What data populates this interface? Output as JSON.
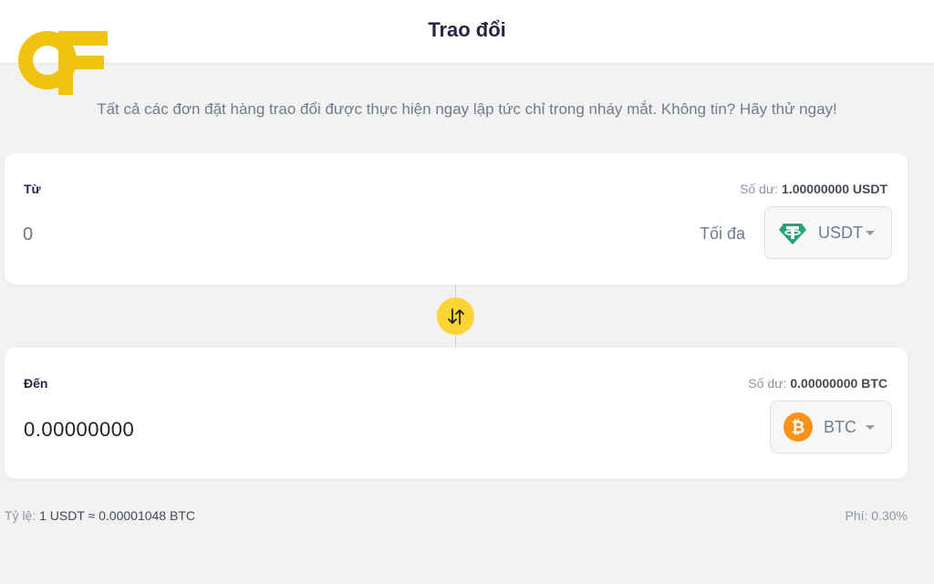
{
  "header": {
    "title": "Trao đổi"
  },
  "tagline": "Tất cả các đơn đặt hàng trao đổi được thực hiện ngay lập tức chỉ trong nháy mắt. Không tin? Hãy thử ngay!",
  "from_card": {
    "label": "Từ",
    "balance_label": "Số dư:",
    "balance_value": "1.00000000 USDT",
    "amount_placeholder": "0",
    "max_label": "Tối đa",
    "asset": "USDT",
    "asset_icon": "tether-icon",
    "asset_color": "#26a17b"
  },
  "to_card": {
    "label": "Đến",
    "balance_label": "Số dư:",
    "balance_value": "0.00000000 BTC",
    "amount": "0.00000000",
    "asset": "BTC",
    "asset_icon": "bitcoin-icon",
    "asset_color": "#f7931a"
  },
  "swap_icon": "swap-arrows-icon",
  "footer": {
    "rate_label": "Tỷ lệ:",
    "rate_value": "1 USDT ≈ 0.00001048 BTC",
    "fee": "Phí: 0.30%"
  },
  "colors": {
    "accent": "#fcd535",
    "logo": "#f0c30f"
  }
}
